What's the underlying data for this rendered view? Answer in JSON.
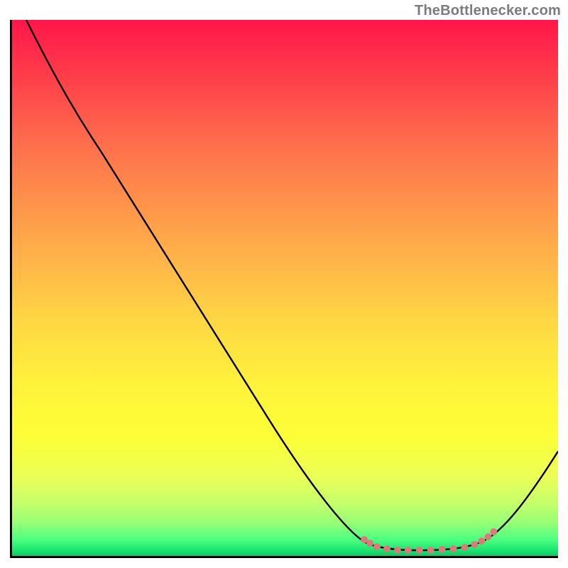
{
  "watermark": "TheBottlenecker.com",
  "chart_data": {
    "type": "line",
    "title": "",
    "xlabel": "",
    "ylabel": "",
    "x_range": [
      0,
      100
    ],
    "y_range": [
      0,
      100
    ],
    "background": {
      "type": "vertical-gradient",
      "meaning": "bottleneck severity (red=high, green=low)",
      "stops": [
        {
          "pos": 0.0,
          "color": "#ff1649"
        },
        {
          "pos": 0.1,
          "color": "#ff3b4a"
        },
        {
          "pos": 0.22,
          "color": "#ff6a4c"
        },
        {
          "pos": 0.33,
          "color": "#ff8f4b"
        },
        {
          "pos": 0.45,
          "color": "#ffb549"
        },
        {
          "pos": 0.57,
          "color": "#ffd943"
        },
        {
          "pos": 0.68,
          "color": "#fff23b"
        },
        {
          "pos": 0.78,
          "color": "#fcff37"
        },
        {
          "pos": 0.85,
          "color": "#edff55"
        },
        {
          "pos": 0.9,
          "color": "#c7ff6a"
        },
        {
          "pos": 0.94,
          "color": "#94ff77"
        },
        {
          "pos": 0.97,
          "color": "#4bff80"
        },
        {
          "pos": 0.99,
          "color": "#18e46e"
        },
        {
          "pos": 1.0,
          "color": "#12c763"
        }
      ]
    },
    "series": [
      {
        "name": "curve",
        "color": "#000000",
        "x": [
          3,
          10,
          16,
          25,
          35,
          47,
          55,
          61,
          65,
          70,
          75,
          80,
          84,
          87,
          91,
          100
        ],
        "y": [
          100,
          85,
          76,
          63,
          48,
          26,
          13,
          5,
          3,
          1,
          1,
          1,
          2,
          3,
          6,
          20
        ]
      }
    ],
    "markers": {
      "name": "optimal-range",
      "color": "#d97b7b",
      "x": [
        65,
        66,
        67,
        69,
        71,
        73,
        75,
        77,
        79,
        81,
        83,
        85,
        86,
        87,
        88
      ],
      "y": [
        3,
        2.3,
        1.7,
        1.3,
        1,
        1,
        1,
        1,
        1.1,
        1.3,
        1.5,
        2,
        2.6,
        3.4,
        4.4
      ]
    }
  }
}
